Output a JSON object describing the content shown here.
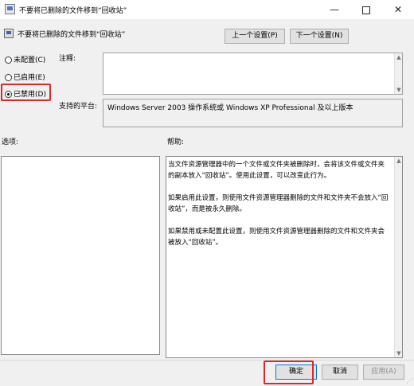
{
  "window": {
    "title": "不要将已删除的文件移到“回收站”",
    "minimize_glyph": "—",
    "close_glyph": "✕"
  },
  "header": {
    "title": "不要将已删除的文件移到“回收站”",
    "prev_button": "上一个设置(P)",
    "next_button": "下一个设置(N)"
  },
  "state": {
    "options": [
      {
        "label": "未配置(C)",
        "selected": false
      },
      {
        "label": "已启用(E)",
        "selected": false
      },
      {
        "label": "已禁用(D)",
        "selected": true
      }
    ]
  },
  "comment": {
    "label": "注释:",
    "value": ""
  },
  "platform": {
    "label": "支持的平台:",
    "value": "Windows Server 2003 操作系统或 Windows XP Professional 及以上版本"
  },
  "options_section": {
    "label": "选项:"
  },
  "help": {
    "label": "帮助:",
    "paragraphs": [
      "当文件资源管理器中的一个文件或文件夹被删除时，会将该文件或文件夹的副本放入“回收站”。使用此设置，可以改变此行为。",
      "如果启用此设置，则使用文件资源管理器删除的文件和文件夹不会放入“回收站”，而是被永久删除。",
      "如果禁用或未配置此设置，则使用文件资源管理器删除的文件和文件夹会被放入“回收站”。"
    ]
  },
  "footer": {
    "ok": "确定",
    "cancel": "取消",
    "apply": "应用(A)"
  },
  "colors": {
    "highlight": "#e0262b",
    "focus": "#0078d7"
  }
}
